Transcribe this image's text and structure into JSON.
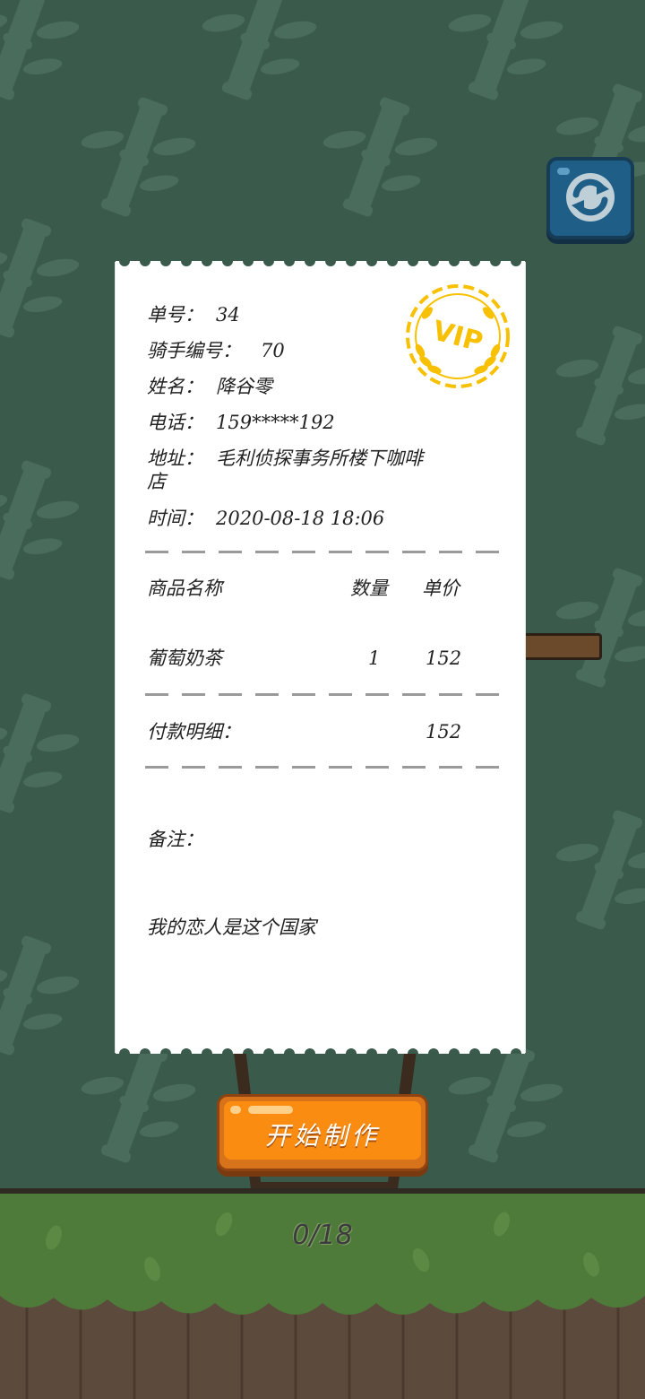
{
  "theme": {
    "background": "#3a5b4c",
    "accent_orange": "#fb8c12",
    "refresh_blue": "#1f5e86",
    "vip_gold": "#f7c000"
  },
  "top_controls": {
    "refresh_icon": "refresh-icon"
  },
  "receipt": {
    "order_no_label": "单号：",
    "order_no": "34",
    "rider_label": "骑手编号：",
    "rider_no": "70",
    "name_label": "姓名：",
    "name": "降谷零",
    "phone_label": "电话：",
    "phone": "159*****192",
    "address_label": "地址：",
    "address_line1": "毛利侦探事务所楼下咖啡",
    "address_line2": "店",
    "time_label": "时间：",
    "time": "2020-08-18 18:06",
    "vip_badge": "VIP",
    "columns": {
      "product": "商品名称",
      "quantity": "数量",
      "price": "单价"
    },
    "items": [
      {
        "name": "葡萄奶茶",
        "quantity": "1",
        "price": "152"
      }
    ],
    "payment_label": "付款明细：",
    "payment_total": "152",
    "note_label": "备注：",
    "note": "我的恋人是这个国家"
  },
  "actions": {
    "start_label": "开始制作"
  },
  "progress": {
    "text": "0/18",
    "current": 0,
    "total": 18
  }
}
